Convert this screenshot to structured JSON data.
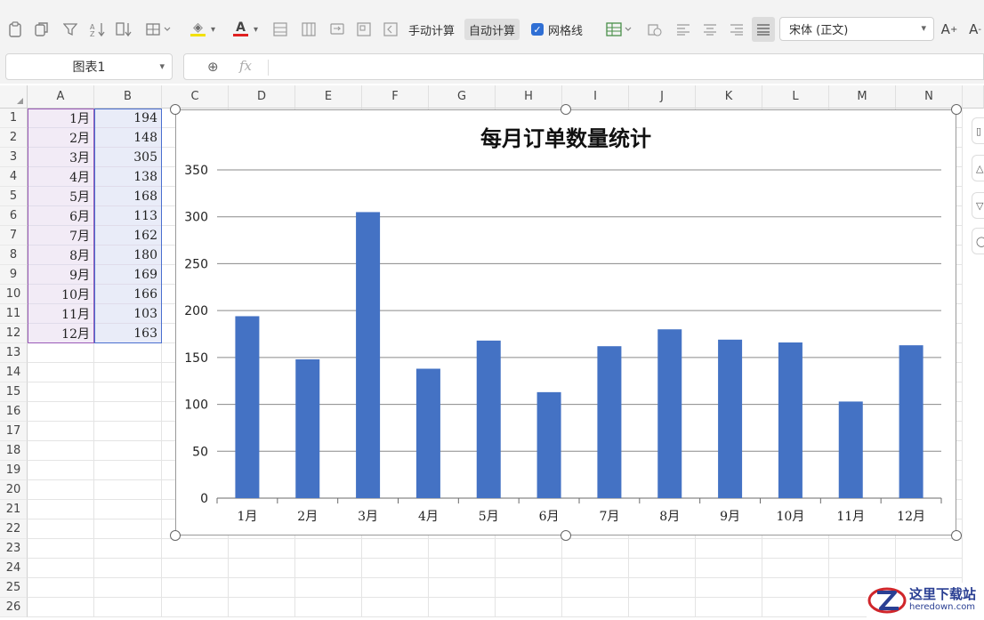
{
  "toolbar": {
    "manual_calc": "手动计算",
    "auto_calc": "自动计算",
    "gridlines_label": "网格线",
    "gridlines_checked": true,
    "font_name": "宋体 (正文)",
    "highlight_color": "#f2e000",
    "font_color": "#e02020"
  },
  "formula_bar": {
    "name_box": "图表1",
    "fx_symbol": "fx",
    "formula": ""
  },
  "columns": [
    "A",
    "B",
    "C",
    "D",
    "E",
    "F",
    "G",
    "H",
    "I",
    "J",
    "K",
    "L",
    "M",
    "N"
  ],
  "rows": [
    "1",
    "2",
    "3",
    "4",
    "5",
    "6",
    "7",
    "8",
    "9",
    "10",
    "11",
    "12",
    "13",
    "14",
    "15",
    "16",
    "17",
    "18",
    "19",
    "20",
    "21",
    "22",
    "23",
    "24",
    "25",
    "26"
  ],
  "cells": [
    {
      "a": "1月",
      "b": "194"
    },
    {
      "a": "2月",
      "b": "148"
    },
    {
      "a": "3月",
      "b": "305"
    },
    {
      "a": "4月",
      "b": "138"
    },
    {
      "a": "5月",
      "b": "168"
    },
    {
      "a": "6月",
      "b": "113"
    },
    {
      "a": "7月",
      "b": "162"
    },
    {
      "a": "8月",
      "b": "180"
    },
    {
      "a": "9月",
      "b": "169"
    },
    {
      "a": "10月",
      "b": "166"
    },
    {
      "a": "11月",
      "b": "103"
    },
    {
      "a": "12月",
      "b": "163"
    }
  ],
  "chart_data": {
    "type": "bar",
    "title": "每月订单数量统计",
    "categories": [
      "1月",
      "2月",
      "3月",
      "4月",
      "5月",
      "6月",
      "7月",
      "8月",
      "9月",
      "10月",
      "11月",
      "12月"
    ],
    "series": [
      {
        "values": [
          194,
          148,
          305,
          138,
          168,
          113,
          162,
          180,
          169,
          166,
          103,
          163
        ],
        "color": "#4472c4"
      }
    ],
    "ylim": [
      0,
      350
    ],
    "yticks": [
      "0",
      "50",
      "100",
      "150",
      "200",
      "250",
      "300",
      "350"
    ],
    "grid": true,
    "legend": "none"
  },
  "watermark": {
    "cn": "这里下载站",
    "en": "heredown.com"
  }
}
